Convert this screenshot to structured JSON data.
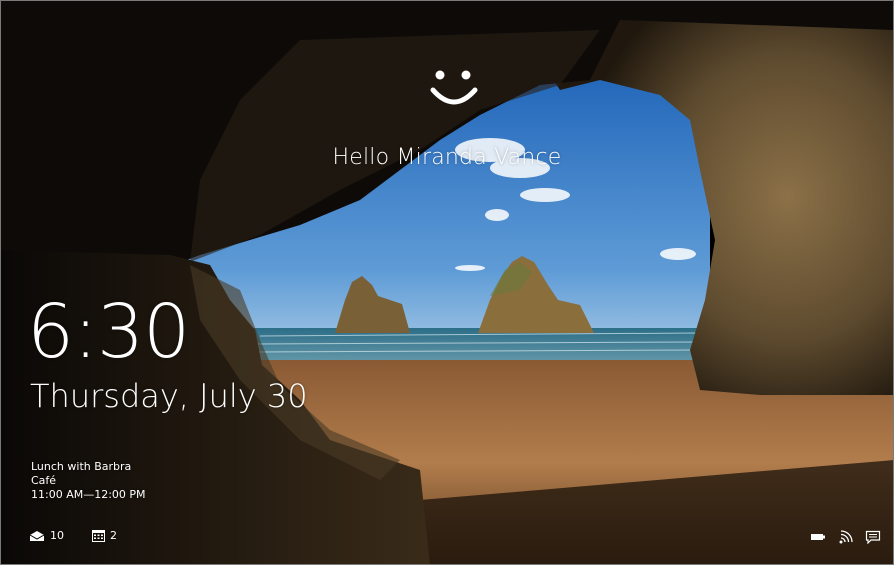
{
  "lock_screen": {
    "greeting": "Hello Miranda Vance",
    "time": "6:30",
    "date": "Thursday, July 30",
    "event": {
      "title": "Lunch with Barbra",
      "location": "Café",
      "time_range": "11:00 AM—12:00 PM"
    },
    "badges": {
      "mail_icon": "mail-icon",
      "mail_count": "10",
      "calendar_icon": "calendar-icon",
      "calendar_count": "2"
    },
    "tray_icons": [
      "battery-icon",
      "wifi-icon",
      "notification-icon"
    ]
  },
  "colors": {
    "text": "#ffffff",
    "sky_top": "#1e63b8",
    "sky_bottom": "#86b8df",
    "sea": "#3c7c93",
    "sand": "#b07a4a",
    "rock": "#6e5a3a"
  }
}
